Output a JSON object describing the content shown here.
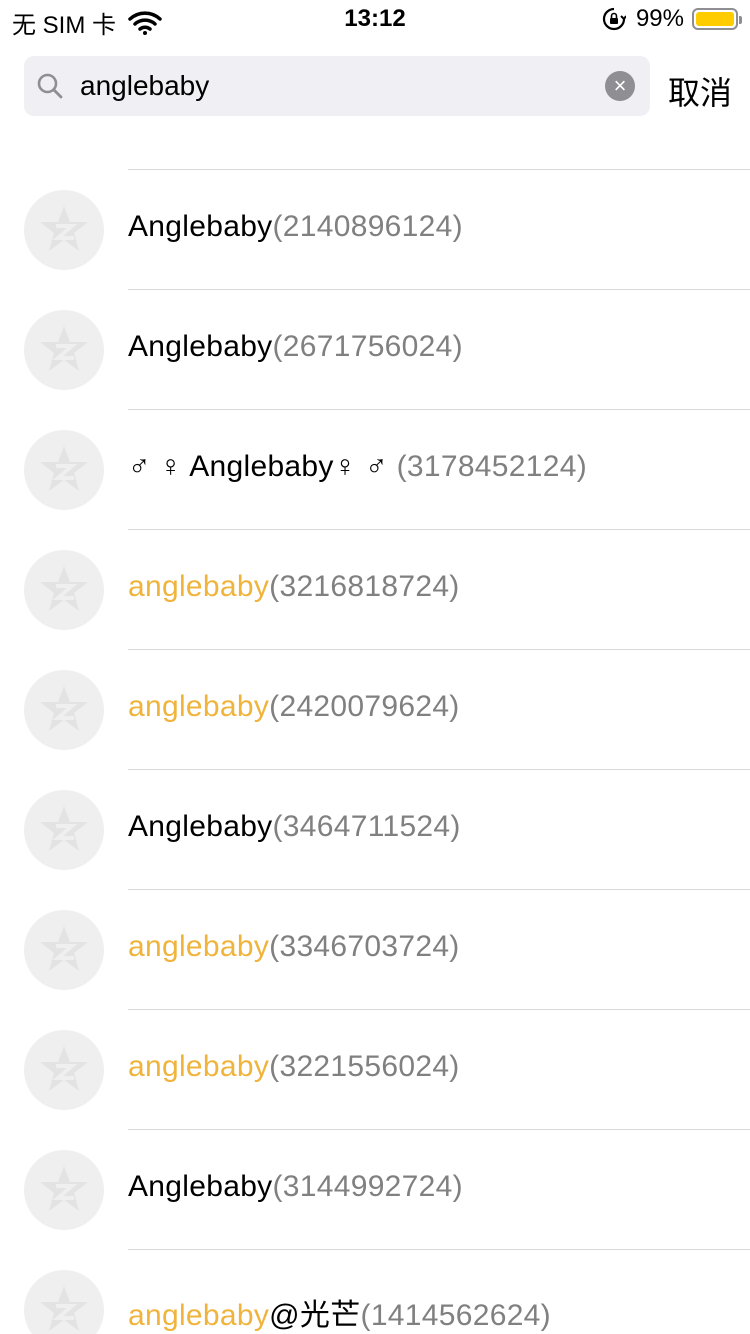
{
  "status_bar": {
    "carrier": "无 SIM 卡",
    "time": "13:12",
    "battery": "99%",
    "battery_level": 0.99,
    "battery_color": "#ffcc00",
    "icons": [
      "wifi-icon",
      "orientation-lock-icon",
      "battery-icon"
    ]
  },
  "search": {
    "query": "anglebaby",
    "clear_icon": "clear-icon",
    "cancel_label": "取消"
  },
  "colors": {
    "highlight": "#f0b43c",
    "qq_number": "#808080"
  },
  "results": [
    {
      "name": "Anglebaby",
      "qq": "(2140896124)",
      "highlight": false
    },
    {
      "name": "Anglebaby",
      "qq": "(2671756024)",
      "highlight": false
    },
    {
      "name": "♂ ♀ Anglebaby♀ ♂",
      "qq": " (3178452124)",
      "highlight": false
    },
    {
      "name": "anglebaby",
      "qq": "(3216818724)",
      "highlight": true
    },
    {
      "name": "anglebaby",
      "qq": "(2420079624)",
      "highlight": true
    },
    {
      "name": "Anglebaby",
      "qq": "(3464711524)",
      "highlight": false
    },
    {
      "name": "anglebaby",
      "qq": "(3346703724)",
      "highlight": true
    },
    {
      "name": "anglebaby",
      "qq": "(3221556024)",
      "highlight": true
    },
    {
      "name": "Anglebaby",
      "qq": "(3144992724)",
      "highlight": false
    },
    {
      "name": "anglebaby",
      "suffix": "@光芒",
      "qq": "(1414562624)",
      "highlight": true
    }
  ]
}
